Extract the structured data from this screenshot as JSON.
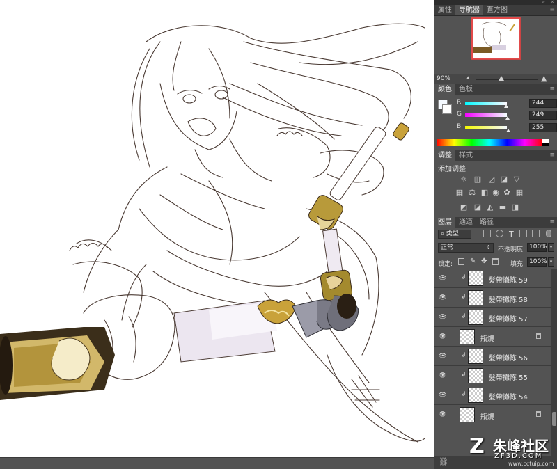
{
  "panels": {
    "navigator_tabs": [
      "属性",
      "导航器",
      "直方图"
    ],
    "zoom": "90%",
    "color_tabs": [
      "颜色",
      "色板"
    ],
    "color": {
      "r": "244",
      "g": "249",
      "b": "255",
      "r_label": "R",
      "g_label": "G",
      "b_label": "B"
    },
    "adjust_tabs": [
      "调整",
      "样式"
    ],
    "adjust_title": "添加调整",
    "layer_tabs": [
      "图层",
      "通道",
      "路径"
    ],
    "layer_filter": "类型",
    "blend_mode": "正常",
    "opacity_label": "不透明度:",
    "opacity": "100%",
    "lock_label": "锁定:",
    "fill_label": "填充:",
    "fill": "100%"
  },
  "layers": [
    {
      "name": "髮帶攤陈 59",
      "clipped": true,
      "locked": false
    },
    {
      "name": "髮帶攤陈 58",
      "clipped": true,
      "locked": false
    },
    {
      "name": "髮帶攤陈 57",
      "clipped": true,
      "locked": false
    },
    {
      "name": "瓶燒",
      "clipped": false,
      "locked": true
    },
    {
      "name": "髮帶攤陈 56",
      "clipped": true,
      "locked": false
    },
    {
      "name": "髮帶攤陈 55",
      "clipped": true,
      "locked": false
    },
    {
      "name": "髮帶攤陈 54",
      "clipped": true,
      "locked": false
    },
    {
      "name": "瓶燒",
      "clipped": false,
      "locked": true
    }
  ],
  "watermark": {
    "logo": "Z",
    "title": "朱峰社区",
    "sub": "ZF3D.COM",
    "url": "www.cctuip.com"
  },
  "colors": {
    "panel_bg": "#535353",
    "tab_bg": "#3c3c3c",
    "accent_red": "#e24a4a",
    "gold": "#c9a23a"
  }
}
